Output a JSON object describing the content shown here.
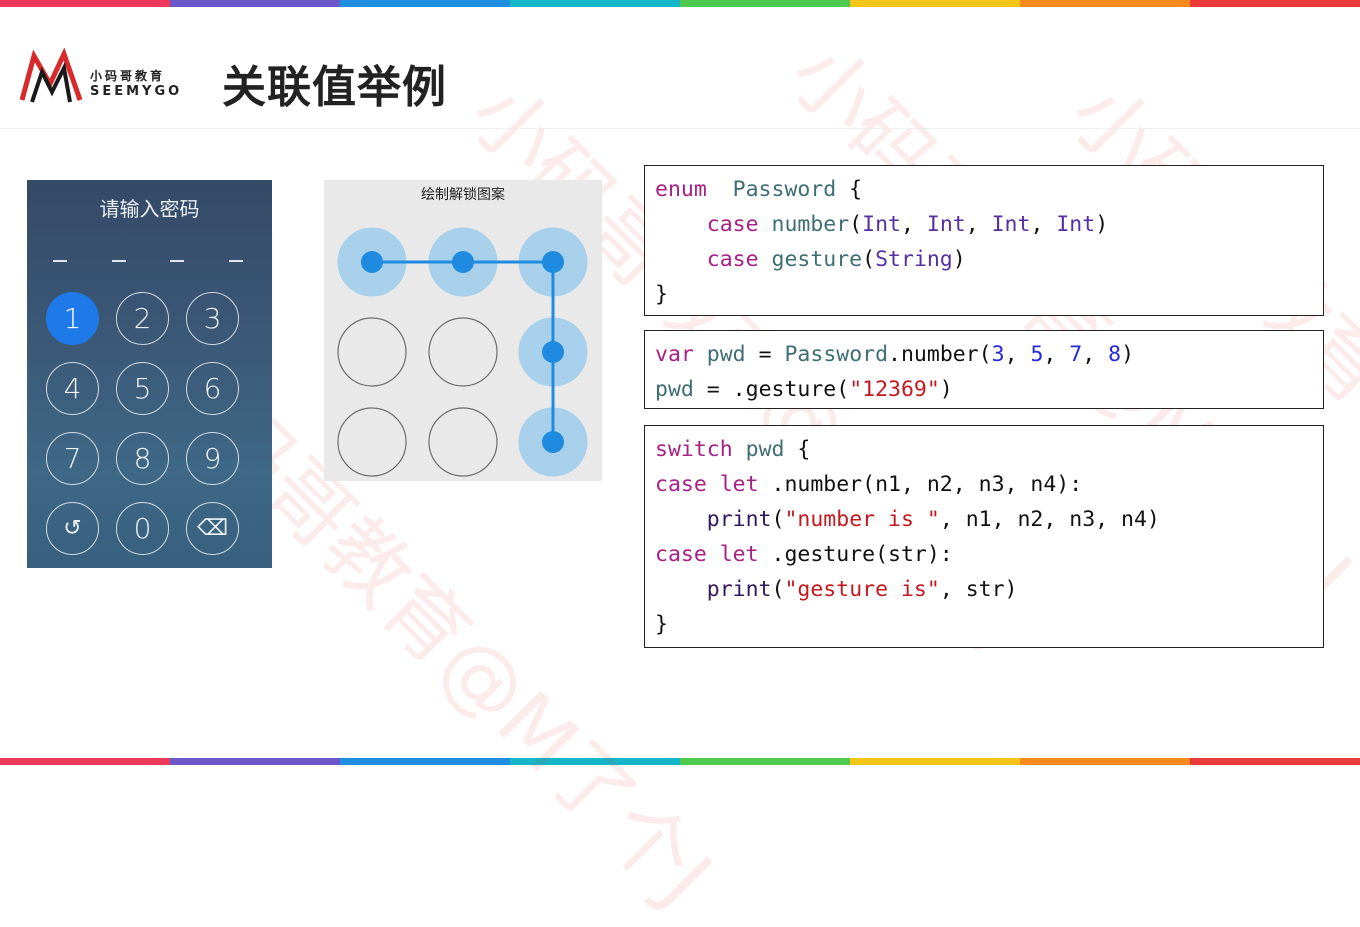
{
  "header": {
    "logo_cn": "小码哥教育",
    "logo_en": "SEEMYGO",
    "title": "关联值举例"
  },
  "stripe_colors": [
    "#ee3a5a",
    "#6b57c8",
    "#1e8ee0",
    "#14b6c8",
    "#4ecb4e",
    "#f5c518",
    "#f68a1e",
    "#ea3a3a"
  ],
  "watermark_text": "小码哥教育@M了个J",
  "keypad": {
    "title": "请输入密码",
    "active_key": "1",
    "keys": [
      "1",
      "2",
      "3",
      "4",
      "5",
      "6",
      "7",
      "8",
      "9",
      "↺",
      "0",
      "⌫"
    ]
  },
  "pattern_lock": {
    "title": "绘制解锁图案",
    "pattern": "12369"
  },
  "code_blocks": [
    {
      "lines": [
        [
          [
            "kw",
            "enum"
          ],
          [
            "",
            "  "
          ],
          [
            "ty2",
            "Password"
          ],
          [
            "",
            " {"
          ]
        ],
        [
          [
            "",
            "    "
          ],
          [
            "kw",
            "case"
          ],
          [
            "",
            " "
          ],
          [
            "ty2",
            "number"
          ],
          [
            "",
            "("
          ],
          [
            "ty",
            "Int"
          ],
          [
            "",
            ", "
          ],
          [
            "ty",
            "Int"
          ],
          [
            "",
            ", "
          ],
          [
            "ty",
            "Int"
          ],
          [
            "",
            ", "
          ],
          [
            "ty",
            "Int"
          ],
          [
            "",
            ")"
          ]
        ],
        [
          [
            "",
            "    "
          ],
          [
            "kw",
            "case"
          ],
          [
            "",
            " "
          ],
          [
            "ty2",
            "gesture"
          ],
          [
            "",
            "("
          ],
          [
            "ty",
            "String"
          ],
          [
            "",
            ")"
          ]
        ],
        [
          [
            "",
            "}"
          ]
        ]
      ]
    },
    {
      "lines": [
        [
          [
            "kw",
            "var"
          ],
          [
            "",
            " "
          ],
          [
            "ty2",
            "pwd"
          ],
          [
            "",
            " = "
          ],
          [
            "ty2",
            "Password"
          ],
          [
            "",
            ".number("
          ],
          [
            "num",
            "3"
          ],
          [
            "",
            ", "
          ],
          [
            "num",
            "5"
          ],
          [
            "",
            ", "
          ],
          [
            "num",
            "7"
          ],
          [
            "",
            ", "
          ],
          [
            "num",
            "8"
          ],
          [
            "",
            ")"
          ]
        ],
        [
          [
            "ty2",
            "pwd"
          ],
          [
            "",
            " = .gesture("
          ],
          [
            "str",
            "\"12369\""
          ],
          [
            "",
            ")"
          ]
        ]
      ]
    },
    {
      "lines": [
        [
          [
            "kw",
            "switch"
          ],
          [
            "",
            " "
          ],
          [
            "ty2",
            "pwd"
          ],
          [
            "",
            " {"
          ]
        ],
        [
          [
            "kw",
            "case"
          ],
          [
            "",
            " "
          ],
          [
            "kw",
            "let"
          ],
          [
            "",
            " .number(n1, n2, n3, n4):"
          ]
        ],
        [
          [
            "",
            "    "
          ],
          [
            "fn",
            "print"
          ],
          [
            "",
            "("
          ],
          [
            "str",
            "\"number is \""
          ],
          [
            "",
            ", n1, n2, n3, n4)"
          ]
        ],
        [
          [
            "kw",
            "case"
          ],
          [
            "",
            " "
          ],
          [
            "kw",
            "let"
          ],
          [
            "",
            " .gesture(str):"
          ]
        ],
        [
          [
            "",
            "    "
          ],
          [
            "fn",
            "print"
          ],
          [
            "",
            "("
          ],
          [
            "str",
            "\"gesture is\""
          ],
          [
            "",
            ", str)"
          ]
        ],
        [
          [
            "",
            "}"
          ]
        ]
      ]
    }
  ]
}
